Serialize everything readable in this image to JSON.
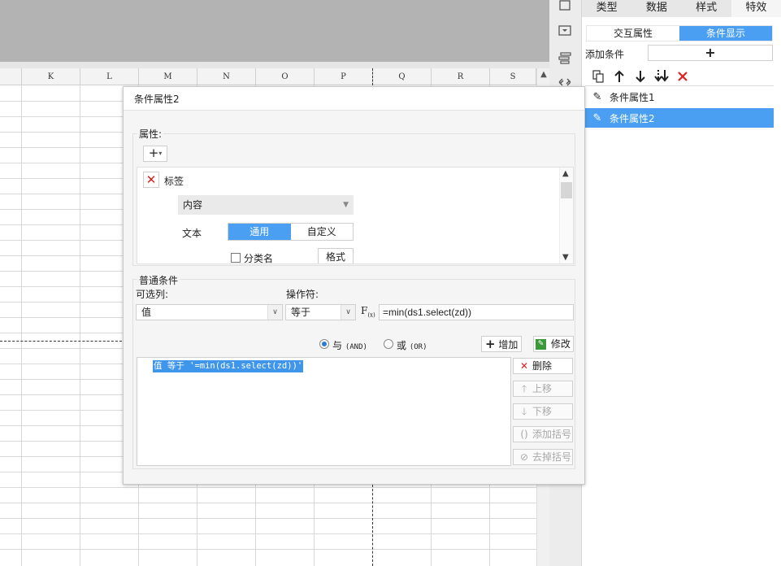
{
  "sheet": {
    "columns": [
      "K",
      "L",
      "M",
      "N",
      "O",
      "P",
      "Q",
      "R",
      "S"
    ],
    "scroll_up_glyph": "▲"
  },
  "right_panel": {
    "tabs": [
      "类型",
      "数据",
      "样式",
      "特效"
    ],
    "active_tab": "特效",
    "subtabs": [
      "交互属性",
      "条件显示"
    ],
    "active_subtab": "条件显示",
    "add_condition_label": "添加条件",
    "add_condition_button": "+",
    "conditions": [
      "条件属性1",
      "条件属性2"
    ],
    "selected_condition": "条件属性2"
  },
  "dialog": {
    "title": "条件属性2",
    "attributes": {
      "group_label": "属性:",
      "add_button": "+",
      "item_label": "标签",
      "content_select": "内容",
      "text_label": "文本",
      "text_options": [
        "通用",
        "自定义"
      ],
      "text_selected": "通用",
      "category_checkbox_label": "分类名",
      "category_checked": false,
      "format_button": "格式"
    },
    "normal_condition": {
      "group_label": "普通条件",
      "column_label": "可选列:",
      "column_value": "值",
      "operator_label": "操作符:",
      "operator_value": "等于",
      "fx_label": "F(x)",
      "formula_value": "=min(ds1.select(zd))"
    },
    "logic": {
      "and_label": "与",
      "and_code": "(AND)",
      "or_label": "或",
      "or_code": "(OR)",
      "selected": "AND"
    },
    "buttons": {
      "add": "增加",
      "modify": "修改",
      "delete": "删除",
      "move_up": "上移",
      "move_down": "下移",
      "add_bracket": "添加括号",
      "remove_bracket": "去掉括号"
    },
    "condition_rows": [
      "值 等于 '=min(ds1.select(zd))'"
    ]
  }
}
